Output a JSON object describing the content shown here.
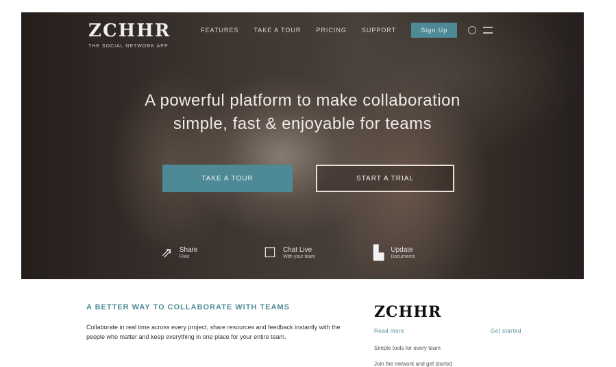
{
  "header": {
    "logo": "ZCHHR",
    "tagline": "THE SOCIAL NETWORK APP",
    "nav": [
      "Features",
      "Take a Tour",
      "Pricing",
      "Support"
    ],
    "cta": "Sign Up",
    "icons": [
      "search-icon",
      "menu-icon"
    ]
  },
  "hero": {
    "headline_line1": "A powerful platform to make collaboration",
    "headline_line2": "simple, fast & enjoyable for teams",
    "primary_button": "TAKE A TOUR",
    "secondary_button": "START A TRIAL",
    "features": [
      {
        "icon": "share-icon",
        "title": "Share",
        "sub": "Files"
      },
      {
        "icon": "chat-icon",
        "title": "Chat Live",
        "sub": "With your team"
      },
      {
        "icon": "doc-icon",
        "title": "Update",
        "sub": "Documents"
      }
    ]
  },
  "content": {
    "intro_title": "A BETTER WAY TO COLLABORATE WITH TEAMS",
    "intro_text": "Collaborate in real time across every project, share resources and feedback instantly with the people who matter and keep everything in one place for your entire team.",
    "side_logo": "ZCHHR",
    "side_links": [
      "Read more",
      "Get started"
    ],
    "side_lines": [
      "Simple tools for every team",
      "Join the network and get started"
    ]
  },
  "colors": {
    "accent": "#4d8a96",
    "hero_dark": "#2a2320"
  }
}
